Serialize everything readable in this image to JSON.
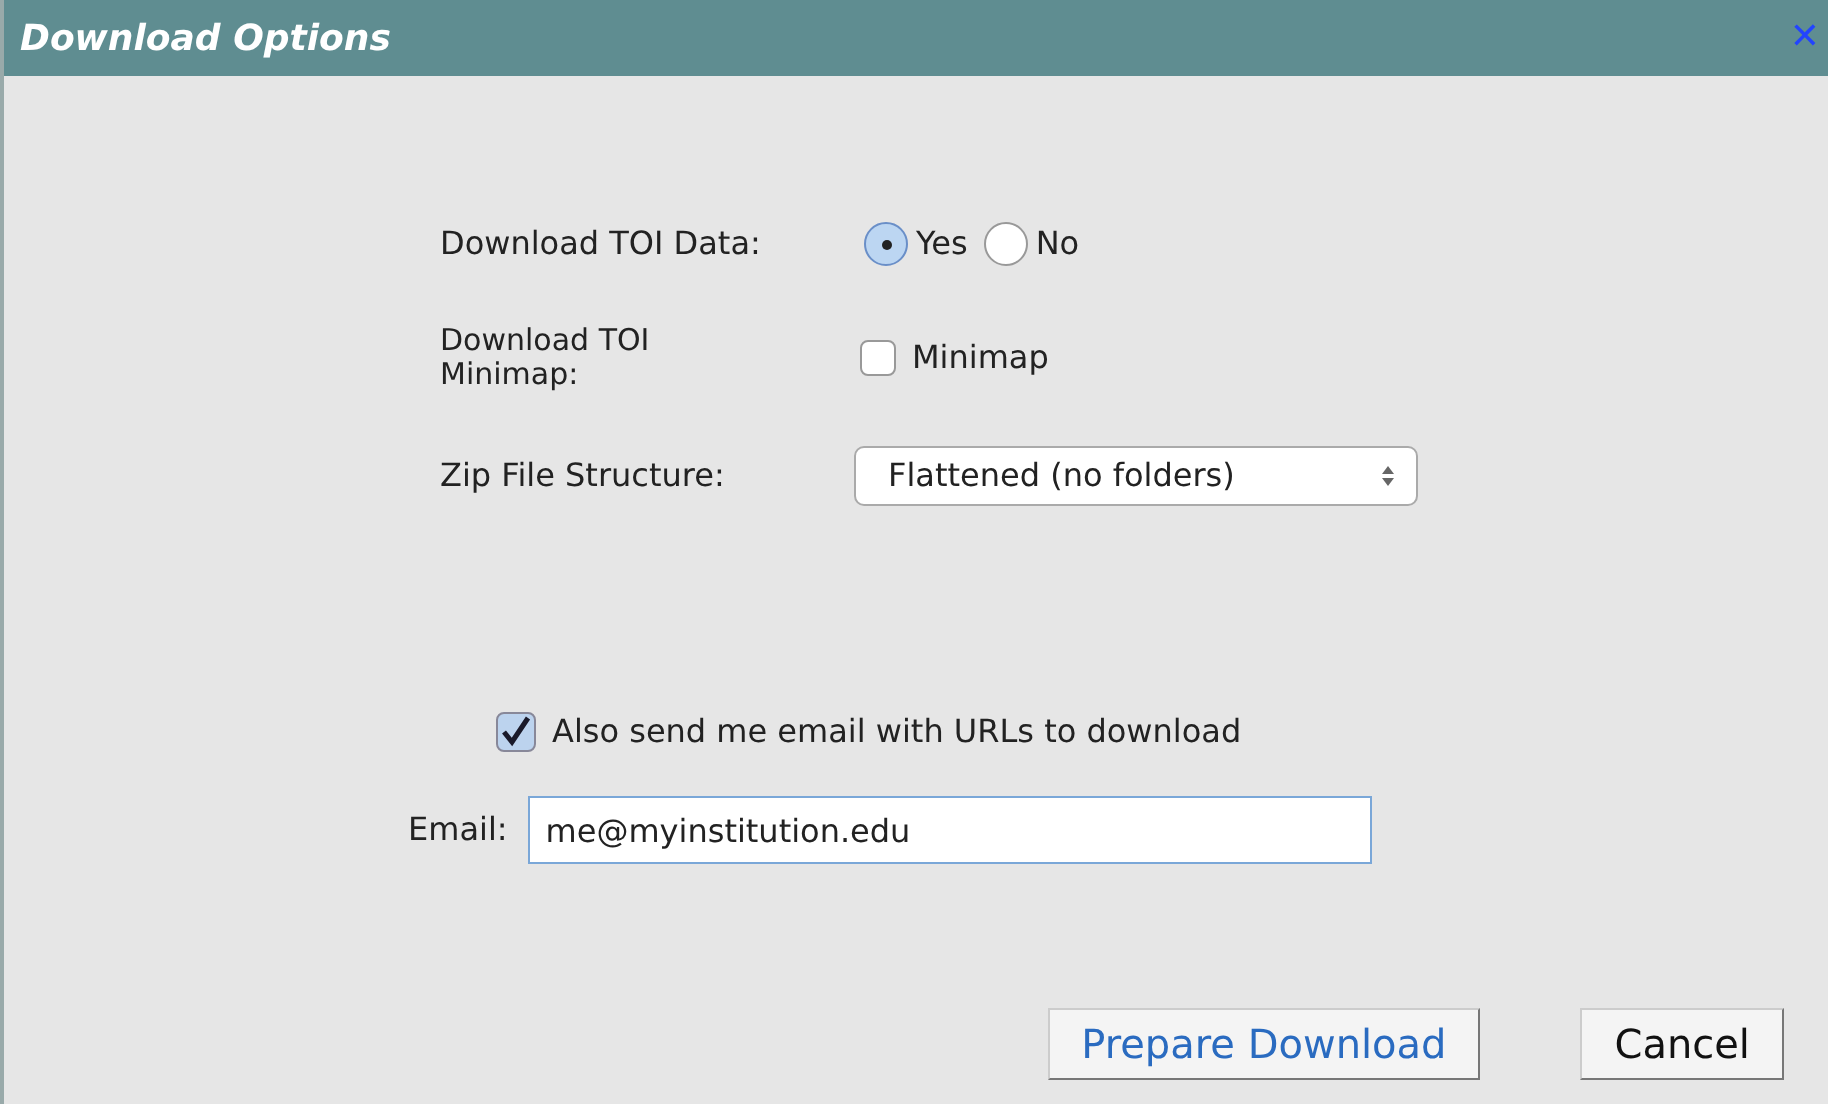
{
  "window": {
    "title": "Download Options",
    "close": "✕"
  },
  "toi_data": {
    "label": "Download TOI Data:",
    "options": [
      {
        "label": "Yes",
        "selected": true
      },
      {
        "label": "No",
        "selected": false
      }
    ]
  },
  "toi_minimap": {
    "label": "Download TOI Minimap:",
    "checkbox": {
      "label": "Minimap",
      "checked": false
    }
  },
  "zip_structure": {
    "label": "Zip File Structure:",
    "value": "Flattened (no folders)"
  },
  "email_option": {
    "label": "Also send me email with URLs to download",
    "checked": true
  },
  "email": {
    "label": "Email:",
    "value": "me@myinstitution.edu"
  },
  "buttons": [
    {
      "label": "Prepare Download",
      "kind": "primary"
    },
    {
      "label": "Cancel",
      "kind": "secondary"
    }
  ]
}
